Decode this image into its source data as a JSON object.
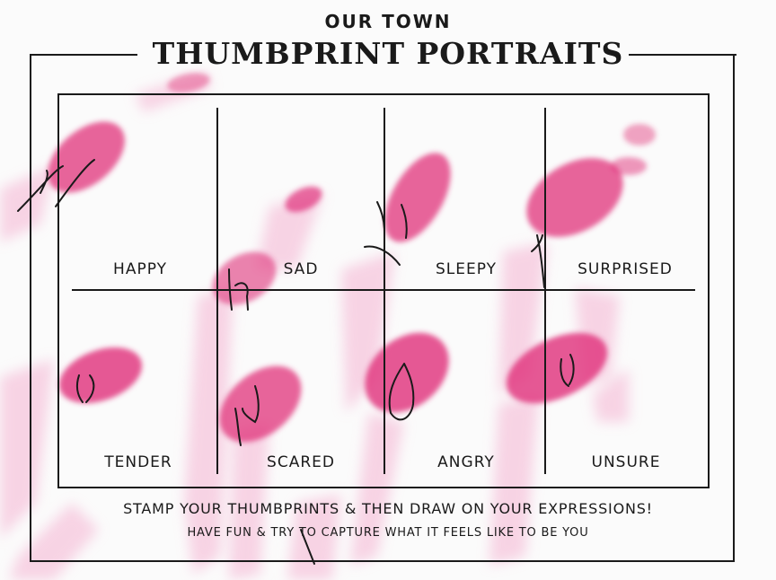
{
  "header": {
    "subtitle": "OUR TOWN",
    "title": "THUMBPRINT PORTRAITS"
  },
  "cells": [
    {
      "label": "HAPPY"
    },
    {
      "label": "SAD"
    },
    {
      "label": "SLEEPY"
    },
    {
      "label": "SURPRISED"
    },
    {
      "label": "TENDER"
    },
    {
      "label": "SCARED"
    },
    {
      "label": "ANGRY"
    },
    {
      "label": "UNSURE"
    }
  ],
  "footer": {
    "instruction": "STAMP YOUR THUMBPRINTS & THEN DRAW ON YOUR EXPRESSIONS!",
    "sub_instruction": "HAVE FUN & TRY TO CAPTURE  WHAT IT FEELS LIKE TO BE YOU"
  },
  "colors": {
    "ink": "#1a1a1a",
    "thumbprint": "#e0307a",
    "smear": "#f2a3c8"
  }
}
